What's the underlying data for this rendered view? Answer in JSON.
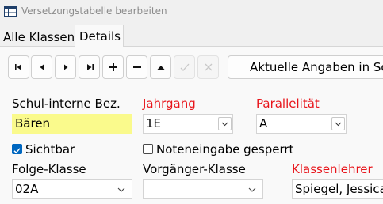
{
  "window": {
    "title": "Versetzungstabelle bearbeiten"
  },
  "tabs": [
    {
      "label": "Alle Klassen",
      "active": false
    },
    {
      "label": "Details",
      "active": true
    }
  ],
  "toolbar": {
    "buttons": [
      {
        "icon": "first-record-icon",
        "enabled": true
      },
      {
        "icon": "previous-record-icon",
        "enabled": true
      },
      {
        "icon": "next-record-icon",
        "enabled": true
      },
      {
        "icon": "last-record-icon",
        "enabled": true
      },
      {
        "icon": "add-icon",
        "enabled": true
      },
      {
        "icon": "remove-icon",
        "enabled": true
      },
      {
        "icon": "up-icon",
        "enabled": true
      },
      {
        "icon": "confirm-icon",
        "enabled": false
      },
      {
        "icon": "cancel-icon",
        "enabled": false
      }
    ],
    "apply_label": "Aktuelle Angaben in Sch"
  },
  "form": {
    "schul_interne_bez": {
      "label": "Schul-interne Bez.",
      "value": "Bären"
    },
    "jahrgang": {
      "label": "Jahrgang",
      "value": "1E"
    },
    "parallelitaet": {
      "label": "Parallelität",
      "value": "A"
    },
    "sichtbar": {
      "label": "Sichtbar",
      "checked": true
    },
    "noteneingabe_gesperrt": {
      "label": "Noteneingabe gesperrt",
      "checked": false
    },
    "folge_klasse": {
      "label": "Folge-Klasse",
      "value": "02A"
    },
    "vorgaenger_klasse": {
      "label": "Vorgänger-Klasse",
      "value": ""
    },
    "klassenlehrer": {
      "label": "Klassenlehrer",
      "value": "Spiegel, Jessica"
    }
  },
  "colors": {
    "required_label": "#e8141a",
    "highlight_field": "#fafa8c",
    "checkbox_accent": "#0067c0"
  }
}
